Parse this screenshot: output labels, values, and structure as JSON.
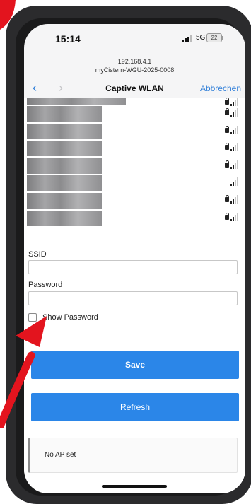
{
  "status_bar": {
    "time": "15:14",
    "network": "5G",
    "battery": "22"
  },
  "browser": {
    "url_line1": "192.168.4.1",
    "url_line2": "myCistern-WGU-2025-0008"
  },
  "nav": {
    "back_icon": "chevron-left-icon",
    "forward_icon": "chevron-right-icon",
    "title": "Captive WLAN",
    "cancel_label": "Abbrechen"
  },
  "networks": [
    {
      "locked": true,
      "signal": 2
    },
    {
      "locked": true,
      "signal": 2
    },
    {
      "locked": true,
      "signal": 2
    },
    {
      "locked": true,
      "signal": 2
    },
    {
      "locked": true,
      "signal": 2
    },
    {
      "locked": false,
      "signal": 2
    },
    {
      "locked": true,
      "signal": 2
    },
    {
      "locked": true,
      "signal": 2
    }
  ],
  "form": {
    "ssid_label": "SSID",
    "ssid_value": "",
    "password_label": "Password",
    "password_value": "",
    "show_password_label": "Show Password",
    "show_password_checked": false,
    "save_label": "Save",
    "refresh_label": "Refresh"
  },
  "status": {
    "text": "No AP set"
  },
  "colors": {
    "accent": "#2b86e8",
    "link": "#2f7ed8",
    "annotation": "#e3141e"
  }
}
